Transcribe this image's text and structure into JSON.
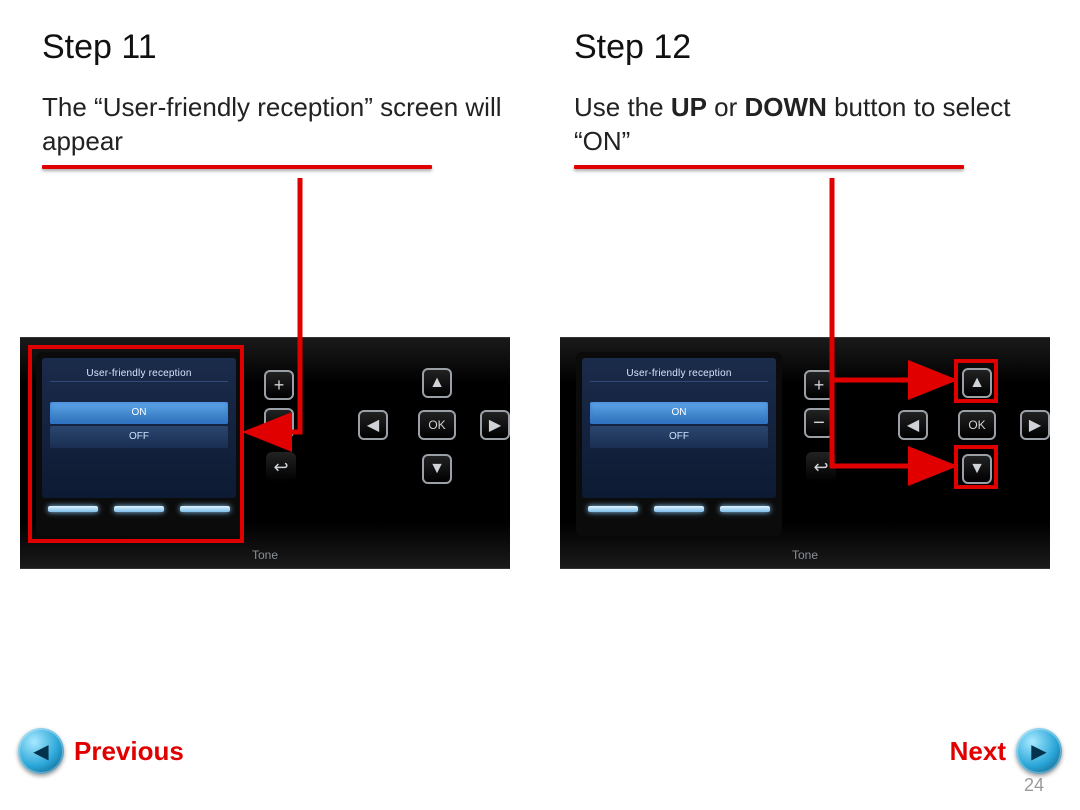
{
  "step11": {
    "title": "Step 11",
    "desc_pre": "The “",
    "desc_em": "User-friendly reception",
    "desc_post": "” screen will appear",
    "screen_title": "User-friendly reception",
    "option_on": "ON",
    "option_off": "OFF"
  },
  "step12": {
    "title": "Step 12",
    "desc_pre": "Use the ",
    "desc_up": "UP",
    "desc_or": " or ",
    "desc_down": "DOWN",
    "desc_post": " button to select “ON”",
    "screen_title": "User-friendly reception",
    "option_on": "ON",
    "option_off": "OFF"
  },
  "buttons": {
    "plus": "+",
    "minus": "−",
    "back": "↩",
    "up": "▲",
    "down": "▼",
    "left": "◀",
    "right": "▶",
    "ok": "OK",
    "tone": "Tone"
  },
  "nav": {
    "prev": "Previous",
    "next": "Next"
  },
  "page_number": "24"
}
